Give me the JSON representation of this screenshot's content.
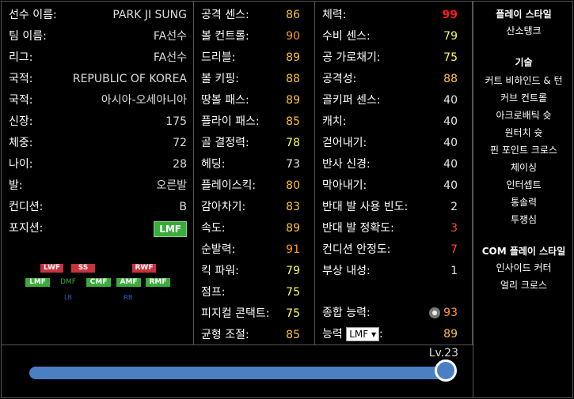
{
  "profile": [
    {
      "label": "선수 이름:",
      "value": "PARK JI SUNG"
    },
    {
      "label": "팀 이름:",
      "value": "FA선수"
    },
    {
      "label": "리그:",
      "value": "FA선수"
    },
    {
      "label": "국적:",
      "value": "REPUBLIC OF KOREA"
    },
    {
      "label": "국적:",
      "value": "아시아-오세아니아"
    },
    {
      "label": "신장:",
      "value": "175"
    },
    {
      "label": "체중:",
      "value": "72"
    },
    {
      "label": "나이:",
      "value": "28"
    },
    {
      "label": "발:",
      "value": "오른발"
    },
    {
      "label": "컨디션:",
      "value": "B"
    },
    {
      "label": "포지션:",
      "value": "LMF"
    }
  ],
  "position_map": {
    "lwf": "LWF",
    "ss": "SS",
    "rwf": "RWF",
    "lmf": "LMF",
    "dmf": "DMF",
    "cmf": "CMF",
    "amf": "AMF",
    "rmf": "RMF",
    "lb": "LB",
    "rb": "RB"
  },
  "stats_col1": [
    {
      "label": "공격 센스:",
      "value": "86",
      "color": "gold"
    },
    {
      "label": "볼 컨트롤:",
      "value": "90",
      "color": "orange"
    },
    {
      "label": "드리블:",
      "value": "89",
      "color": "gold"
    },
    {
      "label": "볼 키핑:",
      "value": "88",
      "color": "gold"
    },
    {
      "label": "땅볼 패스:",
      "value": "89",
      "color": "gold"
    },
    {
      "label": "플라이 패스:",
      "value": "85",
      "color": "gold"
    },
    {
      "label": "골 결정력:",
      "value": "78",
      "color": "yellow"
    },
    {
      "label": "헤딩:",
      "value": "73",
      "color": "white"
    },
    {
      "label": "플레이스킥:",
      "value": "80",
      "color": "gold"
    },
    {
      "label": "감아차기:",
      "value": "83",
      "color": "gold"
    },
    {
      "label": "속도:",
      "value": "89",
      "color": "gold"
    },
    {
      "label": "순발력:",
      "value": "91",
      "color": "orange"
    },
    {
      "label": "킥 파워:",
      "value": "79",
      "color": "yellow"
    },
    {
      "label": "점프:",
      "value": "75",
      "color": "yellow"
    },
    {
      "label": "피지컬 콘택트:",
      "value": "75",
      "color": "yellow"
    },
    {
      "label": "균형 조절:",
      "value": "85",
      "color": "gold"
    }
  ],
  "stats_col2": [
    {
      "label": "체력:",
      "value": "99",
      "color": "darkred"
    },
    {
      "label": "수비 센스:",
      "value": "79",
      "color": "yellow"
    },
    {
      "label": "공 가로채기:",
      "value": "75",
      "color": "yellow"
    },
    {
      "label": "공격성:",
      "value": "88",
      "color": "gold"
    },
    {
      "label": "골키퍼 센스:",
      "value": "40",
      "color": "white"
    },
    {
      "label": "캐치:",
      "value": "40",
      "color": "white"
    },
    {
      "label": "걷어내기:",
      "value": "40",
      "color": "white"
    },
    {
      "label": "반사 신경:",
      "value": "40",
      "color": "white"
    },
    {
      "label": "막아내기:",
      "value": "40",
      "color": "white"
    },
    {
      "label": "반대 발 사용 빈도:",
      "value": "2",
      "color": "white"
    },
    {
      "label": "반대 발 정확도:",
      "value": "3",
      "color": "red"
    },
    {
      "label": "컨디션 안정도:",
      "value": "7",
      "color": "red"
    },
    {
      "label": "부상 내성:",
      "value": "1",
      "color": "white"
    }
  ],
  "overall": {
    "label": "종합 능력:",
    "value": "93"
  },
  "ability": {
    "label": "능력",
    "selected": "LMF",
    "suffix": ":",
    "value": "89"
  },
  "sidebar": {
    "play_style_title": "플레이 스타일",
    "play_style": "산소탱크",
    "skills_title": "기술",
    "skills": [
      "커트 비하인드 & 턴",
      "커브 컨트롤",
      "아크로배틱 슛",
      "원터치 슛",
      "핀 포인트 크로스",
      "체이싱",
      "인터셉트",
      "통솔력",
      "투쟁심"
    ],
    "com_title": "COM 플레이 스타일",
    "com_styles": [
      "인사이드 커터",
      "얼리 크로스"
    ]
  },
  "level": {
    "label": "Lv.23",
    "progress": 1.0
  },
  "colors": {
    "gold": "#ffc33a",
    "yellow": "#ffff55",
    "orange": "#ff9933",
    "red": "#ff4d33",
    "darkred": "#ff1a1a",
    "badge_green": "#3bab3b",
    "badge_red": "#c8323c",
    "slider_blue": "#4a7fc4"
  }
}
